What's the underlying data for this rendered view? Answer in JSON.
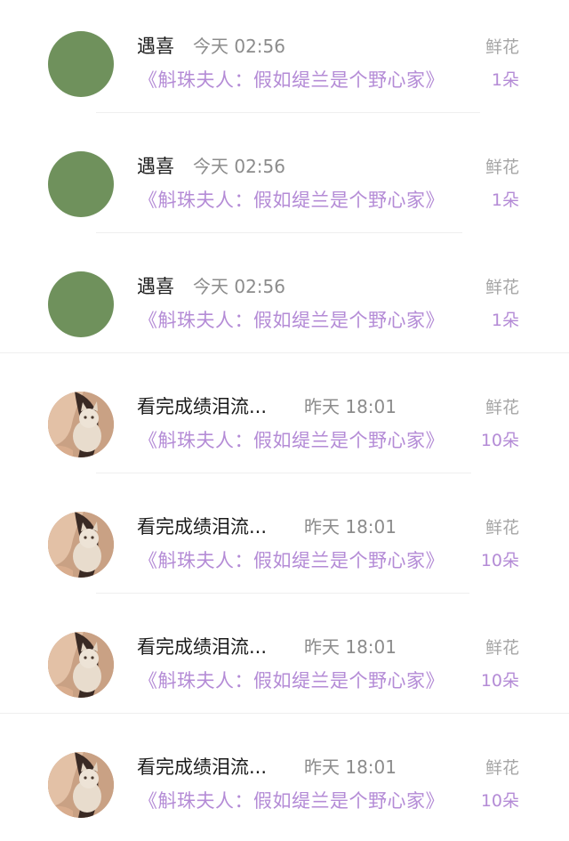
{
  "records": [
    {
      "name": "遇喜",
      "time": "今天 02:56",
      "book": "《斛珠夫人：假如缇兰是个野心家》",
      "gift_type": "鲜花",
      "gift_count": "1朵",
      "avatar": "green-circle"
    },
    {
      "name": "遇喜",
      "time": "今天 02:56",
      "book": "《斛珠夫人：假如缇兰是个野心家》",
      "gift_type": "鲜花",
      "gift_count": "1朵",
      "avatar": "green-circle"
    },
    {
      "name": "遇喜",
      "time": "今天 02:56",
      "book": "《斛珠夫人：假如缇兰是个野心家》",
      "gift_type": "鲜花",
      "gift_count": "1朵",
      "avatar": "green-circle"
    },
    {
      "name": "看完成绩泪流...",
      "time": "昨天 18:01",
      "book": "《斛珠夫人：假如缇兰是个野心家》",
      "gift_type": "鲜花",
      "gift_count": "10朵",
      "avatar": "girl-with-cat-photo"
    },
    {
      "name": "看完成绩泪流...",
      "time": "昨天 18:01",
      "book": "《斛珠夫人：假如缇兰是个野心家》",
      "gift_type": "鲜花",
      "gift_count": "10朵",
      "avatar": "girl-with-cat-photo"
    },
    {
      "name": "看完成绩泪流...",
      "time": "昨天 18:01",
      "book": "《斛珠夫人：假如缇兰是个野心家》",
      "gift_type": "鲜花",
      "gift_count": "10朵",
      "avatar": "girl-with-cat-photo"
    },
    {
      "name": "看完成绩泪流...",
      "time": "昨天 18:01",
      "book": "《斛珠夫人：假如缇兰是个野心家》",
      "gift_type": "鲜花",
      "gift_count": "10朵",
      "avatar": "girl-with-cat-photo"
    }
  ],
  "colors": {
    "name_text": "#1b1b1b",
    "time_text": "#8c8c8c",
    "book_link": "#b48bd6",
    "gift_type_text": "#a6a6a6",
    "gift_count_text": "#b48bd6",
    "green_avatar": "#6f915c",
    "divider": "#efefef"
  }
}
